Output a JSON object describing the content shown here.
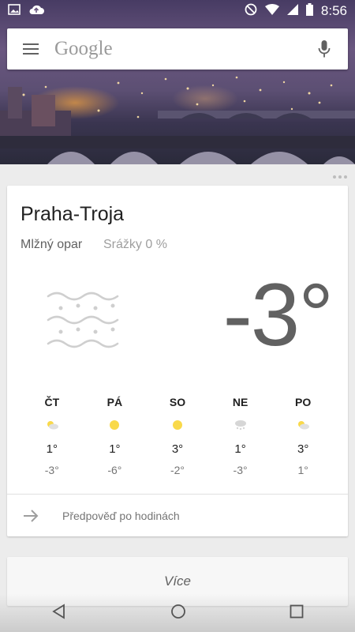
{
  "status_bar": {
    "time": "8:56"
  },
  "search": {
    "label": "Google"
  },
  "weather": {
    "location": "Praha-Troja",
    "condition": "Mlžný opar",
    "precipitation": "Srážky 0 %",
    "temperature": "-3°",
    "forecast": [
      {
        "day": "ČT",
        "icon": "partly-cloudy-icon",
        "high": "1°",
        "low": "-3°"
      },
      {
        "day": "PÁ",
        "icon": "sun-icon",
        "high": "1°",
        "low": "-6°"
      },
      {
        "day": "SO",
        "icon": "sun-icon",
        "high": "3°",
        "low": "-2°"
      },
      {
        "day": "NE",
        "icon": "snow-icon",
        "high": "1°",
        "low": "-3°"
      },
      {
        "day": "PO",
        "icon": "partly-cloudy-icon",
        "high": "3°",
        "low": "1°"
      }
    ],
    "hourly_link": "Předpověď po hodinách"
  },
  "more": {
    "label": "Více"
  },
  "colors": {
    "sun": "#f9d94a",
    "text_dark": "#212121",
    "text_muted": "#757575"
  }
}
